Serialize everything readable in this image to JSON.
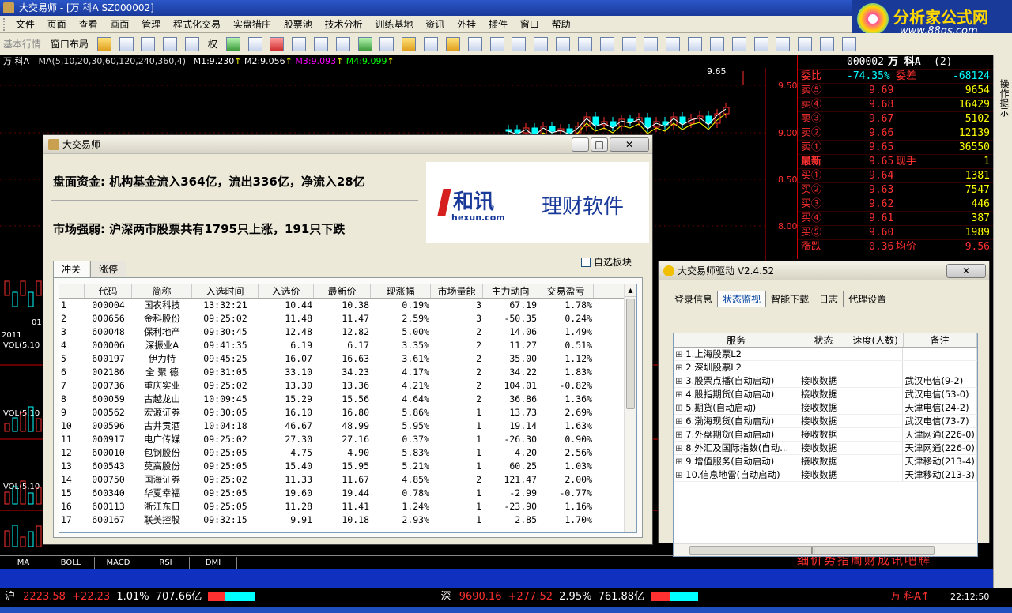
{
  "window": {
    "title": "大交易师 - [万  科A SZ000002]"
  },
  "brand": {
    "logo_text": "分析家公式网",
    "logo_url": "www.88gs.com"
  },
  "menu": [
    "文件",
    "页面",
    "查看",
    "画面",
    "管理",
    "程式化交易",
    "实盘猎庄",
    "股票池",
    "技术分析",
    "训练基地",
    "资讯",
    "外挂",
    "插件",
    "窗口",
    "帮助"
  ],
  "toolbar": {
    "basic_label": "基本行情",
    "window_layout_label": "窗口布局",
    "right_label": "权"
  },
  "chart": {
    "stock_label": "万  科A",
    "ma_params": "MA(5,10,20,30,60,120,240,360,4)",
    "m1": "M1:9.230",
    "m2": "M2:9.056",
    "m3": "M3:9.093",
    "m4": "M4:9.099",
    "price_high_label": "9.65",
    "y_axis": [
      "9.50",
      "9.00",
      "8.50",
      "8.00"
    ],
    "vol_label": "VOL(5,10",
    "year_label": "2011",
    "left_value": "01",
    "tabs": [
      "MA",
      "BOLL",
      "MACD",
      "RSI",
      "DMI"
    ]
  },
  "quote": {
    "code": "000002",
    "name": "万  科A",
    "count": "(2)",
    "weibi_label": "委比",
    "weibi_value": "-74.35%",
    "weicha_label": "委差",
    "weicha_value": "-68124",
    "sells": [
      {
        "label": "卖⑤",
        "price": "9.69",
        "vol": "9654"
      },
      {
        "label": "卖④",
        "price": "9.68",
        "vol": "16429"
      },
      {
        "label": "卖③",
        "price": "9.67",
        "vol": "5102"
      },
      {
        "label": "卖②",
        "price": "9.66",
        "vol": "12139"
      },
      {
        "label": "卖①",
        "price": "9.65",
        "vol": "36550"
      }
    ],
    "latest_label": "最新",
    "latest_value": "9.65",
    "xianshou_label": "现手",
    "xianshou_value": "1",
    "buys": [
      {
        "label": "买①",
        "price": "9.64",
        "vol": "1381"
      },
      {
        "label": "买②",
        "price": "9.63",
        "vol": "7547"
      },
      {
        "label": "买③",
        "price": "9.62",
        "vol": "446"
      },
      {
        "label": "买④",
        "price": "9.61",
        "vol": "387"
      },
      {
        "label": "买⑤",
        "price": "9.60",
        "vol": "1989"
      }
    ],
    "zhangdie_label": "涨跌",
    "zhangdie_value": "0.36",
    "junjia_label": "均价",
    "junjia_value": "9.56"
  },
  "side_tab": "操作提示",
  "news_ticker": "细价势指周财成讯吧解",
  "statusbar": {
    "sh_label": "沪",
    "sh_index": "2223.58",
    "sh_change": "+22.23",
    "sh_pct": "1.01%",
    "sh_amount": "707.66亿",
    "sz_label": "深",
    "sz_index": "9690.16",
    "sz_change": "+277.52",
    "sz_pct": "2.95%",
    "sz_amount": "761.88亿",
    "ticker_stock": "万  科A↑",
    "time": "22:12:50"
  },
  "dialog1": {
    "title": "大交易师",
    "fund_text": "盘面资金: 机构基金流入364亿，流出336亿，净流入28亿",
    "strength_text": "市场强弱: 沪深两市股票共有1795只上涨，191只下跌",
    "ad_brand": "和讯",
    "ad_brand_url": "hexun.com",
    "ad_slogan": "理财软件",
    "tabs": [
      "冲关",
      "涨停"
    ],
    "checkbox_label": "自选板块",
    "columns": [
      "",
      "代码",
      "简称",
      "入选时间",
      "入选价",
      "最新价",
      "现涨幅",
      "市场量能",
      "主力动向",
      "交易盈亏"
    ],
    "rows": [
      [
        "1",
        "000004",
        "国农科技",
        "13:32:21",
        "10.44",
        "10.38",
        "0.19%",
        "3",
        "67.19",
        "1.78%"
      ],
      [
        "2",
        "000656",
        "金科股份",
        "09:25:02",
        "11.48",
        "11.47",
        "2.59%",
        "3",
        "-50.35",
        "0.24%"
      ],
      [
        "3",
        "600048",
        "保利地产",
        "09:30:45",
        "12.48",
        "12.82",
        "5.00%",
        "2",
        "14.06",
        "1.49%"
      ],
      [
        "4",
        "000006",
        "深振业A",
        "09:41:35",
        "6.19",
        "6.17",
        "3.35%",
        "2",
        "11.27",
        "0.51%"
      ],
      [
        "5",
        "600197",
        "伊力特",
        "09:45:25",
        "16.07",
        "16.63",
        "3.61%",
        "2",
        "35.00",
        "1.12%"
      ],
      [
        "6",
        "002186",
        "全 聚 德",
        "09:31:05",
        "33.10",
        "34.23",
        "4.17%",
        "2",
        "34.22",
        "1.83%"
      ],
      [
        "7",
        "000736",
        "重庆实业",
        "09:25:02",
        "13.30",
        "13.36",
        "4.21%",
        "2",
        "104.01",
        "-0.82%"
      ],
      [
        "8",
        "600059",
        "古越龙山",
        "10:09:45",
        "15.29",
        "15.56",
        "4.64%",
        "2",
        "36.86",
        "1.36%"
      ],
      [
        "9",
        "000562",
        "宏源证券",
        "09:30:05",
        "16.10",
        "16.80",
        "5.86%",
        "1",
        "13.73",
        "2.69%"
      ],
      [
        "10",
        "000596",
        "古井贡酒",
        "10:04:18",
        "46.67",
        "48.99",
        "5.95%",
        "1",
        "19.14",
        "1.63%"
      ],
      [
        "11",
        "000917",
        "电广传媒",
        "09:25:02",
        "27.30",
        "27.16",
        "0.37%",
        "1",
        "-26.30",
        "0.90%"
      ],
      [
        "12",
        "600010",
        "包钢股份",
        "09:25:05",
        "4.75",
        "4.90",
        "5.83%",
        "1",
        "4.20",
        "2.56%"
      ],
      [
        "13",
        "600543",
        "莫高股份",
        "09:25:05",
        "15.40",
        "15.95",
        "5.21%",
        "1",
        "60.25",
        "1.03%"
      ],
      [
        "14",
        "000750",
        "国海证券",
        "09:25:02",
        "11.33",
        "11.67",
        "4.85%",
        "2",
        "121.47",
        "2.00%"
      ],
      [
        "15",
        "600340",
        "华夏幸福",
        "09:25:05",
        "19.60",
        "19.44",
        "0.78%",
        "1",
        "-2.99",
        "-0.77%"
      ],
      [
        "16",
        "600113",
        "浙江东日",
        "09:25:05",
        "11.28",
        "11.41",
        "1.24%",
        "1",
        "-23.90",
        "1.16%"
      ],
      [
        "17",
        "600167",
        "联美控股",
        "09:32:15",
        "9.91",
        "10.18",
        "2.93%",
        "1",
        "2.85",
        "1.70%"
      ]
    ]
  },
  "dialog2": {
    "title": "大交易师驱动 V2.4.52",
    "tabs": [
      "登录信息",
      "状态监视",
      "智能下载",
      "日志",
      "代理设置"
    ],
    "columns": [
      "服务",
      "状态",
      "速度(人数)",
      "备注"
    ],
    "rows": [
      [
        "1.上海股票L2",
        "",
        "",
        ""
      ],
      [
        "2.深圳股票L2",
        "",
        "",
        ""
      ],
      [
        "3.股票点播(自动启动)",
        "接收数据",
        "",
        "武汉电信(9-2)"
      ],
      [
        "4.股指期货(自动启动)",
        "接收数据",
        "",
        "武汉电信(53-0)"
      ],
      [
        "5.期货(自动启动)",
        "接收数据",
        "",
        "天津电信(24-2)"
      ],
      [
        "6.渤海现货(自动启动)",
        "接收数据",
        "",
        "武汉电信(73-7)"
      ],
      [
        "7.外盘期货(自动启动)",
        "接收数据",
        "",
        "天津网通(226-0)"
      ],
      [
        "8.外汇及国际指数(自动...",
        "接收数据",
        "",
        "天津网通(226-0)"
      ],
      [
        "9.增值服务(自动启动)",
        "接收数据",
        "",
        "天津移动(213-4)"
      ],
      [
        "10.信息地雷(自动启动)",
        "接收数据",
        "",
        "天津移动(213-3)"
      ]
    ]
  },
  "colors": {
    "up": "#ff3030",
    "down": "#00ffff",
    "yellow": "#ffff00",
    "green": "#00ff00",
    "white": "#ffffff"
  }
}
